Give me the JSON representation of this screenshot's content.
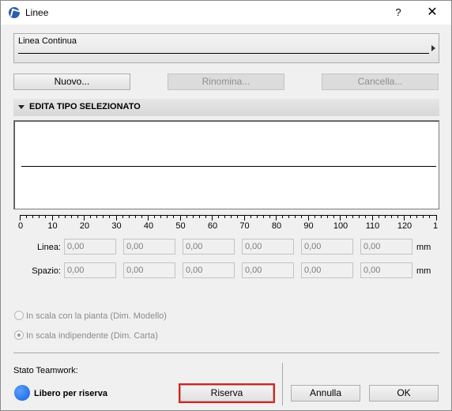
{
  "window": {
    "title": "Linee",
    "help_glyph": "?",
    "close_glyph": "✕"
  },
  "line_type": {
    "selected": "Linea Continua"
  },
  "buttons": {
    "new": "Nuovo...",
    "rename": "Rinomina...",
    "delete": "Cancella...",
    "reserve": "Riserva",
    "cancel": "Annulla",
    "ok": "OK"
  },
  "section": {
    "title": "EDITA TIPO SELEZIONATO"
  },
  "ruler": {
    "labels": [
      "0",
      "10",
      "20",
      "30",
      "40",
      "50",
      "60",
      "70",
      "80",
      "90",
      "100",
      "110",
      "120",
      "1"
    ]
  },
  "rows": {
    "line_label": "Linea:",
    "space_label": "Spazio:",
    "unit": "mm",
    "line_values": [
      "0,00",
      "0,00",
      "0,00",
      "0,00",
      "0,00",
      "0,00"
    ],
    "space_values": [
      "0,00",
      "0,00",
      "0,00",
      "0,00",
      "0,00",
      "0,00"
    ]
  },
  "scale_options": {
    "model": "In scala con la pianta (Dim. Modello)",
    "paper": "In scala indipendente (Dim. Carta)"
  },
  "teamwork": {
    "label": "Stato Teamwork:",
    "status": "Libero per riserva",
    "status_color": "#1e6ff0"
  },
  "colors": {
    "highlight": "#e0201c"
  }
}
